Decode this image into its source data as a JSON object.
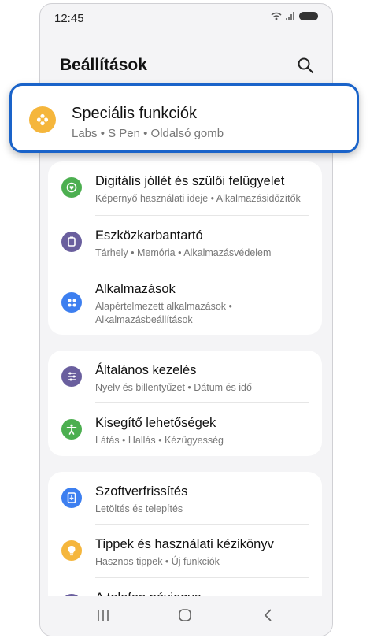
{
  "status": {
    "time": "12:45"
  },
  "header": {
    "title": "Beállítások"
  },
  "highlighted": {
    "title": "Speciális funkciók",
    "subtitle": "Labs  •  S Pen  •  Oldalsó gomb",
    "icon": "gear-icon",
    "color": "#f5b63c"
  },
  "groups": [
    {
      "items": [
        {
          "title": "Digitális jóllét és szülői felügyelet",
          "subtitle": "Képernyő használati ideje  •  Alkalmazásidőzítők",
          "icon": "heart-icon",
          "color": "#4caf50"
        },
        {
          "title": "Eszközkarbantartó",
          "subtitle": "Tárhely  •  Memória  •  Alkalmazásvédelem",
          "icon": "device-icon",
          "color": "#6a5f9e"
        },
        {
          "title": "Alkalmazások",
          "subtitle": "Alapértelmezett alkalmazások  •  Alkalmazásbeállítások",
          "icon": "apps-icon",
          "color": "#3d7ff0"
        }
      ]
    },
    {
      "items": [
        {
          "title": "Általános kezelés",
          "subtitle": "Nyelv és billentyűzet  •  Dátum és idő",
          "icon": "sliders-icon",
          "color": "#6a5f9e"
        },
        {
          "title": "Kisegítő lehetőségek",
          "subtitle": "Látás  •  Hallás  •  Kézügyesség",
          "icon": "accessibility-icon",
          "color": "#4caf50"
        }
      ]
    },
    {
      "items": [
        {
          "title": "Szoftverfrissítés",
          "subtitle": "Letöltés és telepítés",
          "icon": "download-icon",
          "color": "#3d7ff0"
        },
        {
          "title": "Tippek és használati kézikönyv",
          "subtitle": "Hasznos tippek  •  Új funkciók",
          "icon": "bulb-icon",
          "color": "#f5b63c"
        },
        {
          "title": "A telefon névjegye",
          "subtitle": "",
          "icon": "info-icon",
          "color": "#6a5f9e"
        }
      ]
    }
  ]
}
